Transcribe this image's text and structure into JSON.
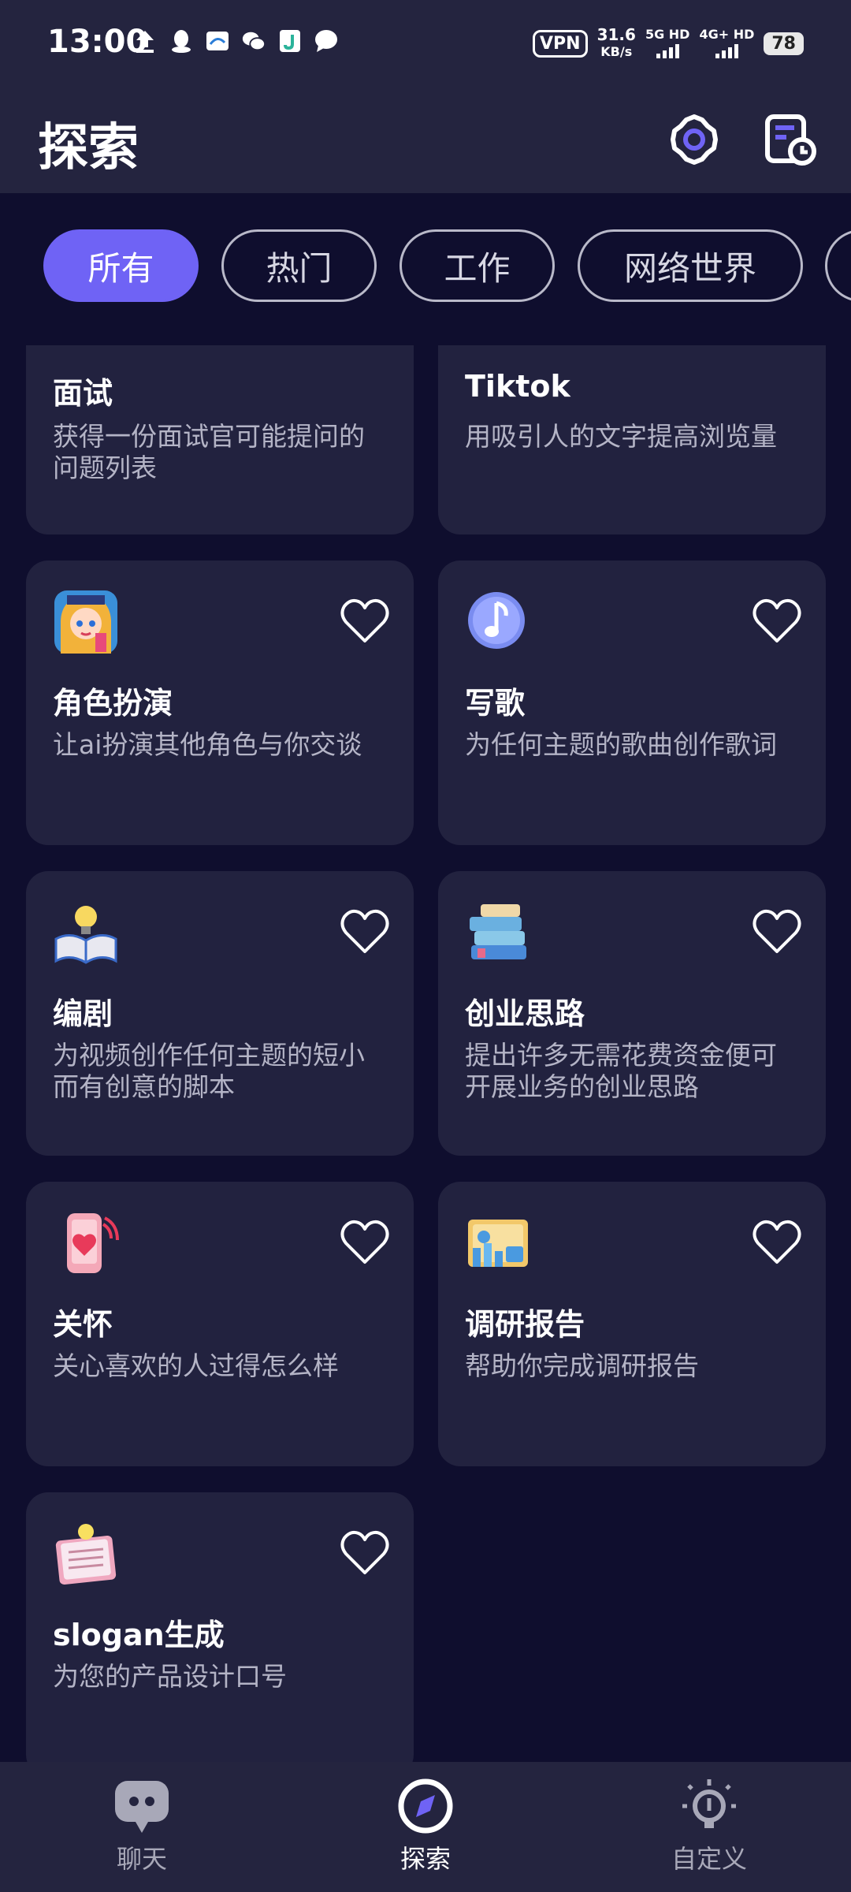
{
  "status_bar": {
    "time": "13:00",
    "vpn": "VPN",
    "speed_value": "31.6",
    "speed_unit": "KB/s",
    "sim1": "5G HD",
    "sim2": "4G+ HD",
    "battery": "78",
    "icons": [
      "upload-icon",
      "qq-icon",
      "app-icon",
      "wechat-icon",
      "app-j-icon",
      "message-icon"
    ]
  },
  "header": {
    "title": "探索",
    "settings_icon": "gear-icon",
    "history_icon": "history-icon"
  },
  "tabs": [
    {
      "label": "所有",
      "active": true
    },
    {
      "label": "热门",
      "active": false
    },
    {
      "label": "工作",
      "active": false
    },
    {
      "label": "网络世界",
      "active": false
    }
  ],
  "cards": [
    {
      "title": "面试",
      "desc": "获得一份面试官可能提问的问题列表"
    },
    {
      "title": "Tiktok",
      "desc": "用吸引人的文字提高浏览量"
    },
    {
      "title": "角色扮演",
      "desc": "让ai扮演其他角色与你交谈",
      "icon": "princess-avatar-icon"
    },
    {
      "title": "写歌",
      "desc": "为任何主题的歌曲创作歌词",
      "icon": "music-note-icon"
    },
    {
      "title": "编剧",
      "desc": "为视频创作任何主题的短小而有创意的脚本",
      "icon": "book-bulb-icon"
    },
    {
      "title": "创业思路",
      "desc": "提出许多无需花费资金便可开展业务的创业思路",
      "icon": "books-stack-icon"
    },
    {
      "title": "关怀",
      "desc": "关心喜欢的人过得怎么样",
      "icon": "phone-heart-icon"
    },
    {
      "title": "调研报告",
      "desc": "帮助你完成调研报告",
      "icon": "report-chart-icon"
    },
    {
      "title": "slogan生成",
      "desc": "为您的产品设计口号",
      "icon": "notebook-bulb-icon"
    }
  ],
  "bottom_nav": [
    {
      "label": "聊天",
      "icon": "chat-bubble-icon",
      "active": false
    },
    {
      "label": "探索",
      "icon": "compass-icon",
      "active": true
    },
    {
      "label": "自定义",
      "icon": "lightbulb-icon",
      "active": false
    }
  ]
}
